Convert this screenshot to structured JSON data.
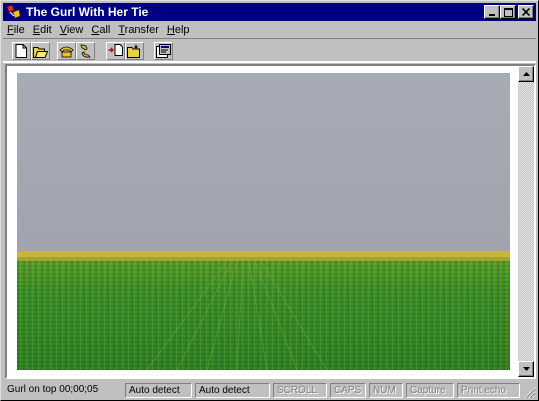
{
  "window": {
    "title": "The Gurl With Her Tie",
    "controls": {
      "minimize": "_",
      "maximize": "□",
      "close": "×"
    }
  },
  "menu": [
    {
      "label": "File",
      "accel": "F",
      "rest": "ile"
    },
    {
      "label": "Edit",
      "accel": "E",
      "rest": "dit"
    },
    {
      "label": "View",
      "accel": "V",
      "rest": "iew"
    },
    {
      "label": "Call",
      "accel": "C",
      "rest": "all"
    },
    {
      "label": "Transfer",
      "accel": "T",
      "rest": "ransfer"
    },
    {
      "label": "Help",
      "accel": "H",
      "rest": "elp"
    }
  ],
  "toolbar": {
    "buttons": [
      "new-icon",
      "open-icon",
      "connect-icon",
      "disconnect-icon",
      "send-icon",
      "receive-icon",
      "properties-icon"
    ]
  },
  "video": {
    "sky_color": "#a4a8b4",
    "horizon_color": "#c8b83a",
    "field_color": "#3c8c2c"
  },
  "status": {
    "connection": "Gurl on top 00;00;05",
    "detect1": "Auto detect",
    "detect2": "Auto detect",
    "scroll": "SCROLL",
    "caps": "CAPS",
    "num": "NUM",
    "capture": "Capture",
    "print_echo": "Print echo"
  }
}
